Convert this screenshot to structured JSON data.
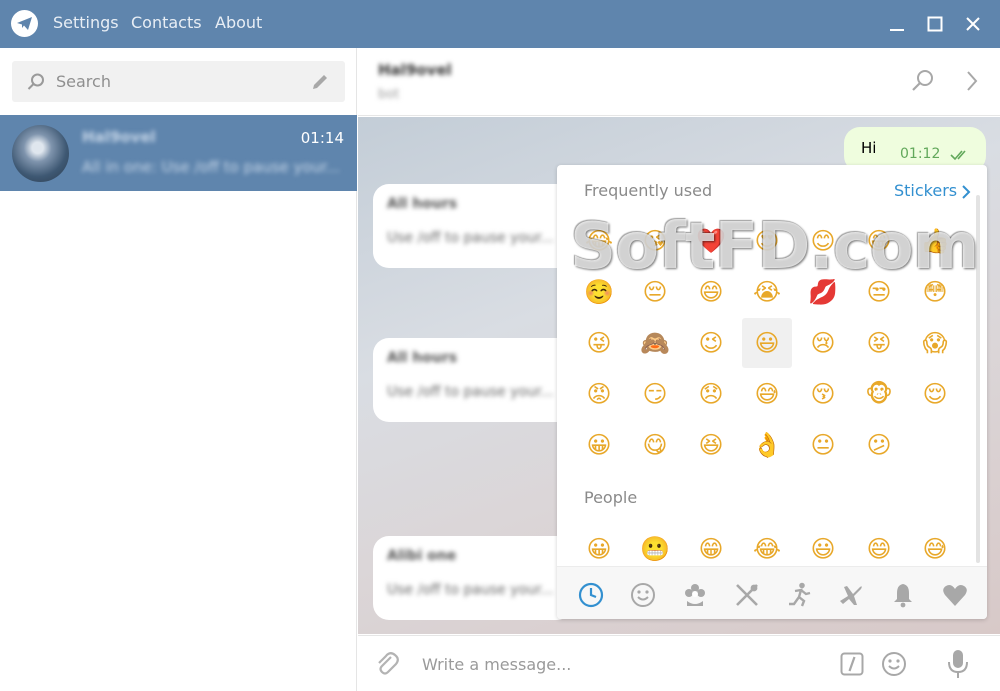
{
  "menu": {
    "settings": "Settings",
    "contacts": "Contacts",
    "about": "About"
  },
  "search": {
    "placeholder": "Search"
  },
  "chat_list": [
    {
      "name": "Hal9ovel",
      "time": "01:14",
      "preview": "All in one: Use /off to pause your..."
    }
  ],
  "header": {
    "name": "Hal9ovel",
    "status": "bot"
  },
  "messages": {
    "outgoing": {
      "text": "Hi",
      "time": "01:12"
    },
    "incoming": [
      {
        "title": "All hours",
        "text": "Use /off to pause your..."
      },
      {
        "title": "All hours",
        "text": "Use /off to pause your..."
      },
      {
        "title": "Alibi one",
        "text": "Use /off to pause your..."
      }
    ]
  },
  "emoji_panel": {
    "frequent_title": "Frequently used",
    "stickers_label": "Stickers",
    "people_title": "People",
    "frequent": [
      "😂",
      "😘",
      "❤️",
      "😍",
      "😊",
      "😁",
      "👍",
      "☺️",
      "😔",
      "😄",
      "😭",
      "💋",
      "😒",
      "😳",
      "😜",
      "🙈",
      "😉",
      "😃",
      "😢",
      "😝",
      "😱",
      "😡",
      "😏",
      "😞",
      "😅",
      "😚",
      "🐵",
      "😌",
      "😀",
      "😋",
      "😆",
      "👌",
      "😐",
      "😕"
    ],
    "people": [
      "😀",
      "😬",
      "😁",
      "😂",
      "😃",
      "😄",
      "😅"
    ],
    "selected_index": 17
  },
  "watermark": "SoftFD.com",
  "compose": {
    "placeholder": "Write a message..."
  },
  "colors": {
    "titlebar": "#5f85ad",
    "accent": "#3390d0",
    "outgoing_bubble": "#effdde"
  }
}
